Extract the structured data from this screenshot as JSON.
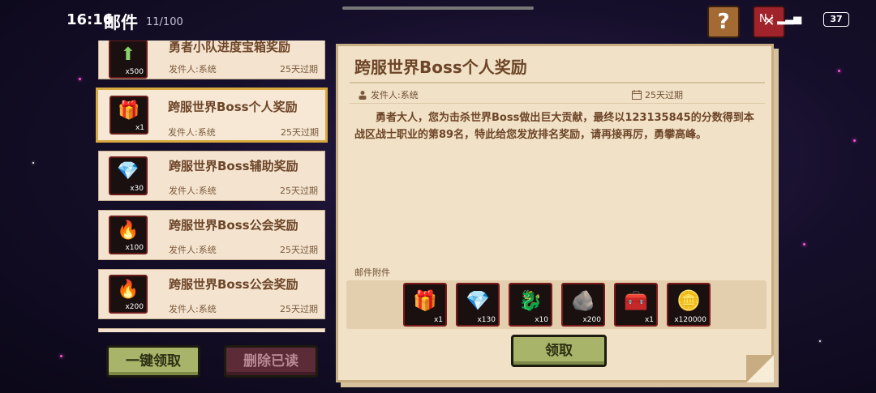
{
  "status_bar": {
    "time": "16:16",
    "title": "邮件",
    "count": "11/100",
    "help_label": "?",
    "close_label": "✕",
    "network": "N ⁝ ▂▃▅",
    "battery": "37"
  },
  "mail_list": [
    {
      "title": "勇者小队进度宝箱奖励",
      "sender": "发件人:系统",
      "expire": "25天过期",
      "icon": "green-arrow-icon",
      "qty": "x500",
      "glyph": "⬆",
      "color": "#8ad26a"
    },
    {
      "title": "跨服世界Boss个人奖励",
      "sender": "发件人:系统",
      "expire": "25天过期",
      "icon": "gift-box-icon",
      "qty": "x1",
      "glyph": "🎁",
      "color": "#4a7bd1"
    },
    {
      "title": "跨服世界Boss辅助奖励",
      "sender": "发件人:系统",
      "expire": "25天过期",
      "icon": "diamond-icon",
      "qty": "x30",
      "glyph": "💎",
      "color": "#6fd6ff"
    },
    {
      "title": "跨服世界Boss公会奖励",
      "sender": "发件人:系统",
      "expire": "25天过期",
      "icon": "purple-flame-icon",
      "qty": "x100",
      "glyph": "🔥",
      "color": "#b37cff"
    },
    {
      "title": "跨服世界Boss公会奖励",
      "sender": "发件人:系统",
      "expire": "25天过期",
      "icon": "purple-flame-icon",
      "qty": "x200",
      "glyph": "🔥",
      "color": "#b37cff"
    }
  ],
  "buttons": {
    "claim_all": "一键领取",
    "delete_read": "删除已读",
    "claim": "领取"
  },
  "detail": {
    "title": "跨服世界Boss个人奖励",
    "sender": "发件人:系统",
    "expire": "25天过期",
    "body": "勇者大人，您为击杀世界Boss做出巨大贡献，最终以123135845的分数得到本战区战士职业的第89名，特此给您发放排名奖励，请再接再厉，勇攀高峰。",
    "attachments_label": "邮件附件",
    "attachments": [
      {
        "icon": "gift-box-icon",
        "qty": "x1",
        "glyph": "🎁"
      },
      {
        "icon": "diamond-icon",
        "qty": "x130",
        "glyph": "💎"
      },
      {
        "icon": "red-pet-icon",
        "qty": "x10",
        "glyph": "🐉"
      },
      {
        "icon": "dark-crystal-icon",
        "qty": "x200",
        "glyph": "🪨"
      },
      {
        "icon": "red-chest-icon",
        "qty": "x1",
        "glyph": "🧰"
      },
      {
        "icon": "gold-coin-icon",
        "qty": "x120000",
        "glyph": "🪙"
      }
    ]
  }
}
